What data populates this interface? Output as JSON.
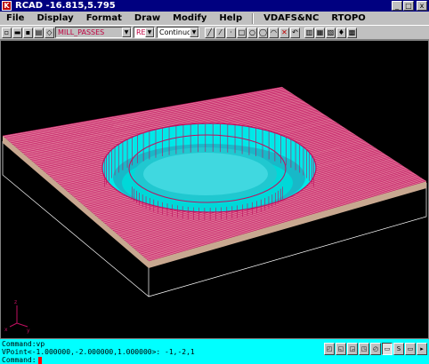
{
  "titlebar": {
    "app_icon_letter": "K",
    "title": "RCAD  -16.815,5.795",
    "minimize": "_",
    "maximize": "□",
    "close": "x"
  },
  "menu": {
    "items": [
      "File",
      "Display",
      "Format",
      "Draw",
      "Modify",
      "Help"
    ],
    "extra": [
      "VDAFS&NC",
      "RTOPO"
    ]
  },
  "toolbar": {
    "layer_value": "MILL_PASSES",
    "color_value": "RED",
    "linetype_value": "Continuous"
  },
  "command": {
    "line1": "Command:vp",
    "line2": "VPoint<-1.000000,-2.000000,1.000000>: -1,-2,1",
    "line3": "Command:"
  },
  "status_buttons": [
    "◰",
    "◱",
    "◲",
    "◳",
    "◴",
    "▭",
    "S",
    "▭",
    "▸"
  ],
  "colors": {
    "plate_top": "#e07898",
    "plate_lines": "#c01060",
    "plate_edge": "#c8a890",
    "pocket": "#00e8e8",
    "box_lines": "#ffffff",
    "command_bg": "#00ffff"
  }
}
